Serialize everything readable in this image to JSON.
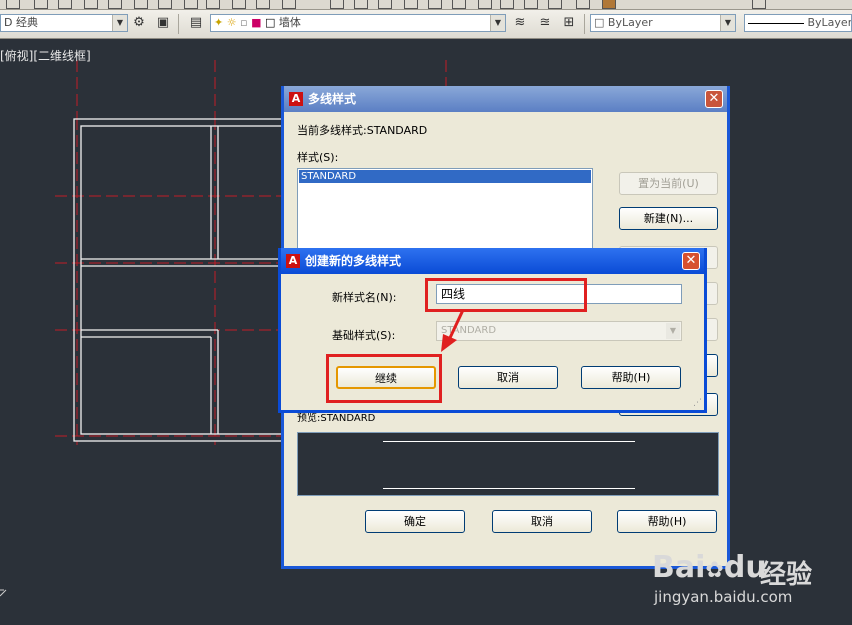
{
  "toolbar": {
    "workspace_combo": "D 经典",
    "layer_combo": "墙体",
    "color_combo": "ByLayer",
    "linetype_combo": "ByLayer"
  },
  "viewport": {
    "label": "[俯视][二维线框]"
  },
  "mlstyle_dialog": {
    "title": "多线样式",
    "current_style": "当前多线样式:STANDARD",
    "styles_label": "样式(S):",
    "styles": [
      "STANDARD"
    ],
    "set_current_button": "置为当前(U)",
    "new_button": "新建(N)...",
    "preview_label": "预览:STANDARD",
    "ok_button": "确定",
    "cancel_button": "取消",
    "help_button": "帮助(H)"
  },
  "new_style_dialog": {
    "title": "创建新的多线样式",
    "name_label": "新样式名(N):",
    "name_value": "四线",
    "base_label": "基础样式(S):",
    "base_value": "STANDARD",
    "continue_button": "继续",
    "cancel_button": "取消",
    "help_button": "帮助(H)"
  },
  "watermark": {
    "brand": "Bai",
    "brand2": "du",
    "jingyan": "经验",
    "url": "jingyan.baidu.com"
  },
  "colors": {
    "canvas_bg": "#2b3139",
    "title_blue": "#0a4bd6",
    "highlight_red": "#e02020"
  }
}
